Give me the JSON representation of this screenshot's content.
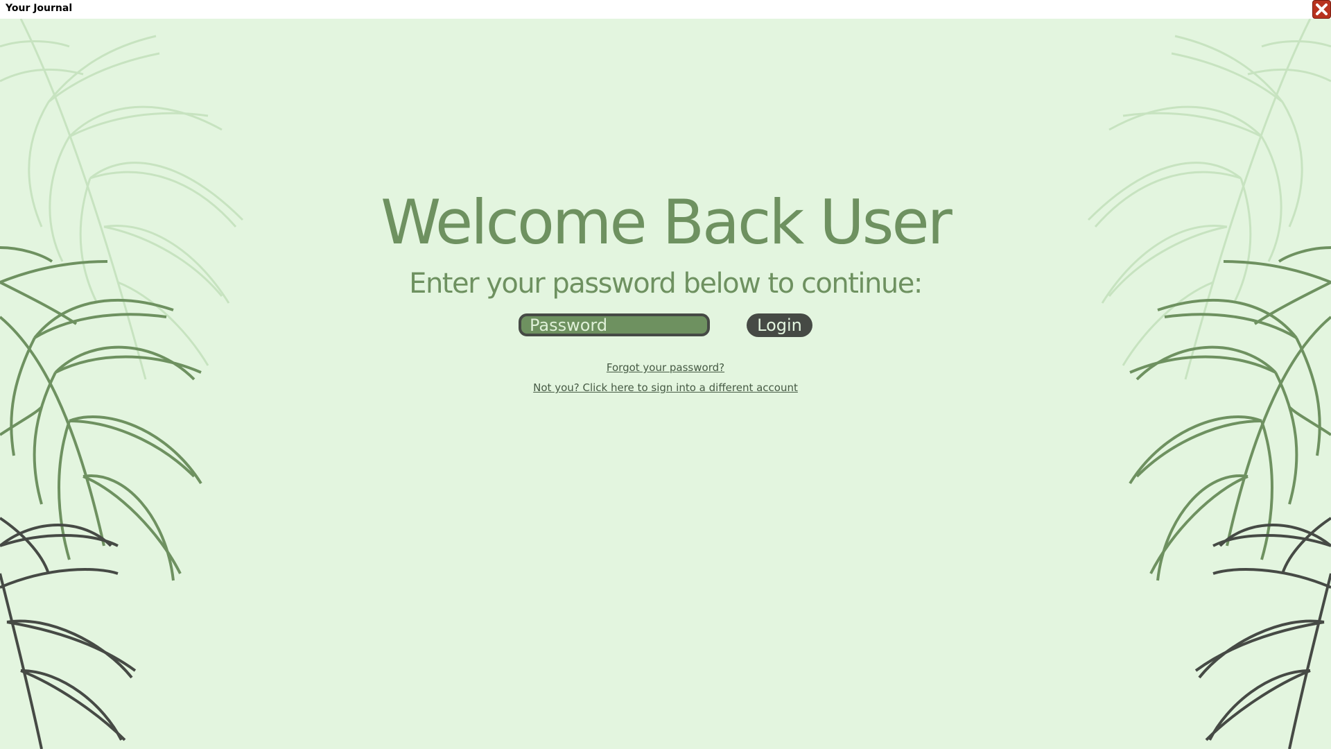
{
  "window": {
    "title": "Your Journal",
    "close_icon": "close-icon"
  },
  "colors": {
    "background": "#e3f5df",
    "accent_green": "#6e9160",
    "dark_gray": "#464a45",
    "close_red": "#b8331f"
  },
  "login": {
    "heading": "Welcome Back User",
    "subheading": "Enter your password below to continue:",
    "password_placeholder": "Password",
    "password_value": "",
    "login_label": "Login",
    "forgot_link": "Forgot your password?",
    "switch_account_link": "Not you? Click here to sign into a different account"
  },
  "decorations": {
    "left_icon": "fern-leaves-icon",
    "right_icon": "fern-leaves-icon"
  }
}
